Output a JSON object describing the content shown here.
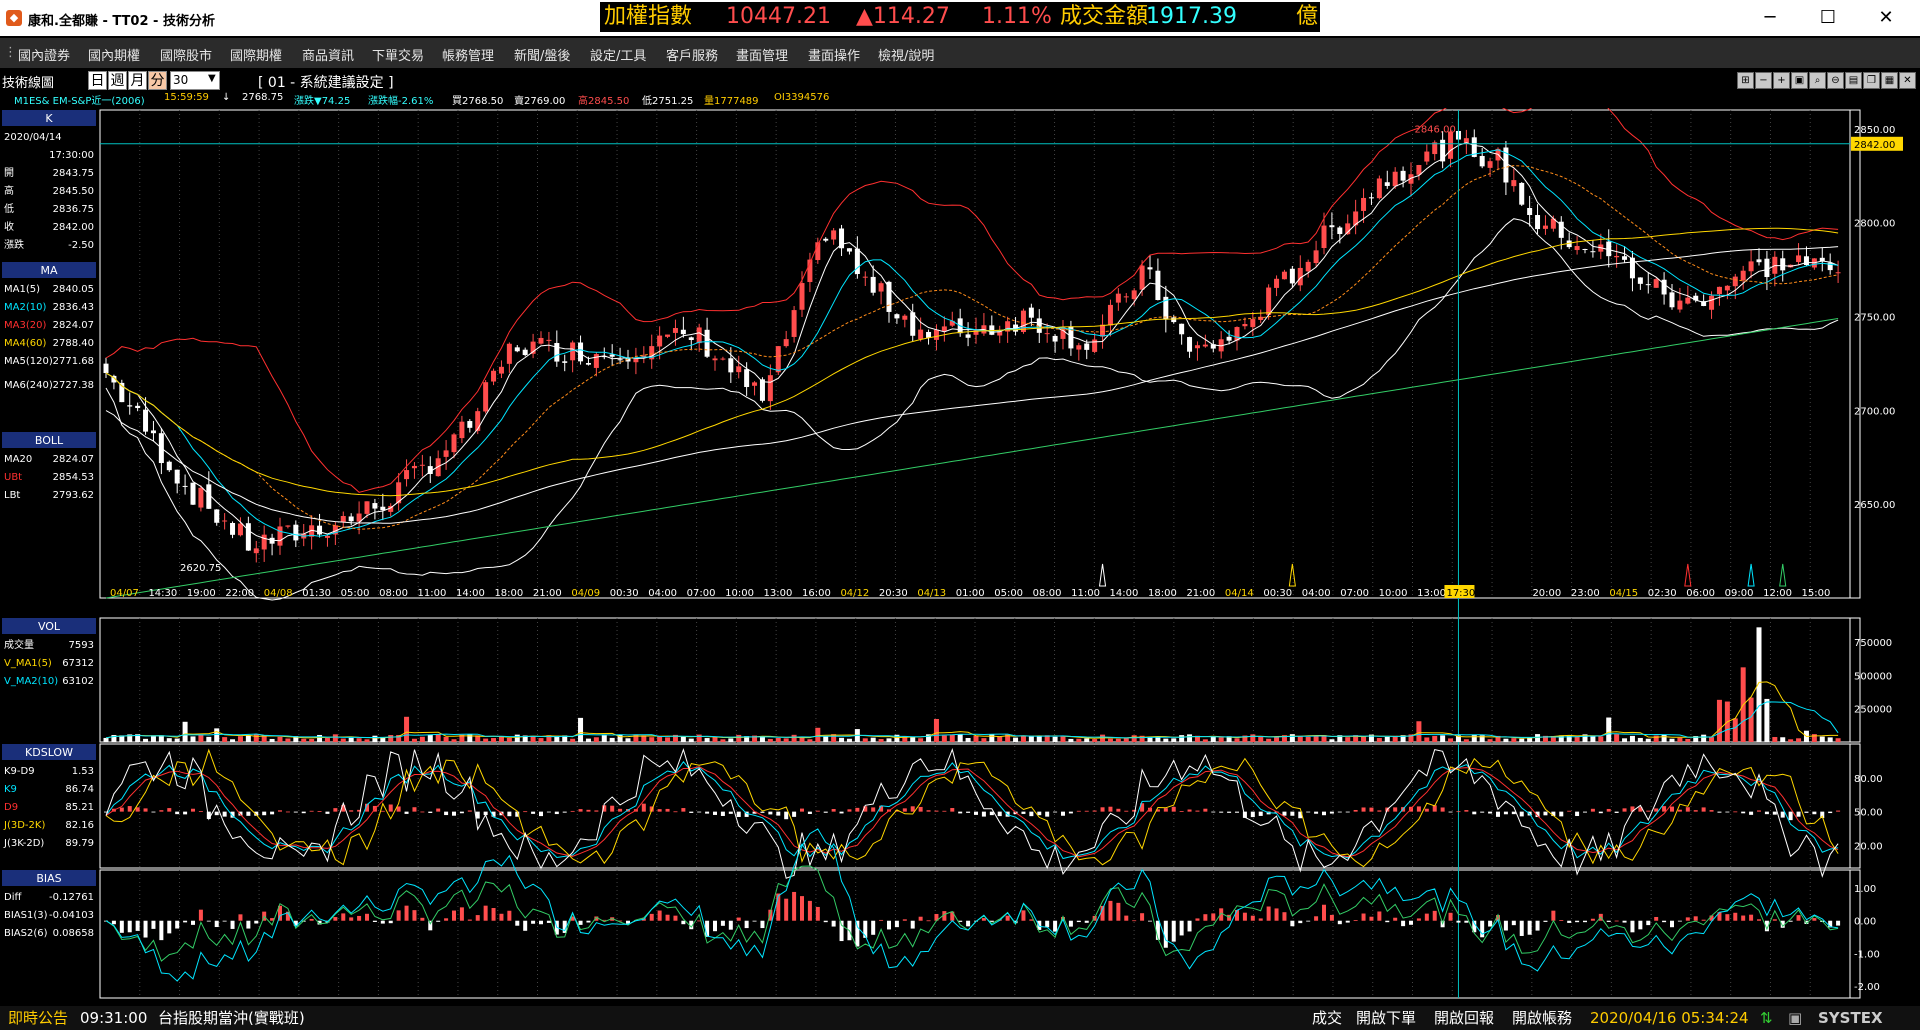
{
  "window": {
    "title": "康和.全都賺 - TT02 - 技術分析",
    "minimize": "─",
    "maximize": "☐",
    "close": "✕"
  },
  "ticker": {
    "label1": "加權指數",
    "index": "10447.21",
    "change": "▲114.27",
    "pct": "1.11%",
    "label2": "成交金額",
    "amount": "1917.39",
    "unit": "億"
  },
  "menu": [
    "國內證券",
    "國內期權",
    "國際股市",
    "國際期權",
    "商品資訊",
    "下單交易",
    "帳務管理",
    "新聞/盤後",
    "設定/工具",
    "客戶服務",
    "畫面管理",
    "畫面操作",
    "檢視/說明"
  ],
  "toolbar": {
    "title": "技術線圖",
    "periods": [
      "日",
      "週",
      "月",
      "分"
    ],
    "selected_period": "分",
    "interval": "30",
    "setting": "[ 01 - 系統建議設定 ]",
    "icon_names": [
      "crosshair-icon",
      "zoom-out-icon",
      "zoom-in-icon",
      "zoom-fit-icon",
      "search-icon",
      "search-minus-icon",
      "print-icon",
      "copy-icon",
      "save-icon",
      "close-icon"
    ]
  },
  "quote": {
    "symbol": "M1ES&  EM-S&P近一(2006)",
    "time": "15:59:59",
    "arrow": "↓",
    "last": "2768.75",
    "change": "漲跌▼74.25",
    "pct": "漲跌幅-2.61%",
    "bid": "買2768.50",
    "ask": "賣2769.00",
    "high": "高2845.50",
    "low": "低2751.25",
    "vol": "量1777489",
    "oi": "OI3394576"
  },
  "panels": {
    "k": {
      "header": "K",
      "date": "2020/04/14",
      "time": "17:30:00",
      "rows": [
        [
          "開",
          "2843.75"
        ],
        [
          "高",
          "2845.50"
        ],
        [
          "低",
          "2836.75"
        ],
        [
          "收",
          "2842.00"
        ],
        [
          "漲跌",
          "-2.50"
        ]
      ]
    },
    "ma": {
      "header": "MA",
      "rows": [
        [
          "MA1(5)",
          "2840.05"
        ],
        [
          "MA2(10)",
          "2836.43"
        ],
        [
          "MA3(20)",
          "2824.07"
        ],
        [
          "MA4(60)",
          "2788.40"
        ],
        [
          "MA5(120)",
          "2771.68"
        ],
        [
          "MA6(240)",
          "2727.38"
        ]
      ]
    },
    "boll": {
      "header": "BOLL",
      "rows": [
        [
          "MA20",
          "2824.07"
        ],
        [
          "UBt",
          "2854.53"
        ],
        [
          "LBt",
          "2793.62"
        ]
      ]
    },
    "vol": {
      "header": "VOL",
      "rows": [
        [
          "成交量",
          "7593"
        ],
        [
          "V_MA1(5)",
          "67312"
        ],
        [
          "V_MA2(10)",
          "63102"
        ]
      ]
    },
    "kd": {
      "header": "KDSLOW",
      "rows": [
        [
          "K9-D9",
          "1.53"
        ],
        [
          "K9",
          "86.74"
        ],
        [
          "D9",
          "85.21"
        ],
        [
          "J(3D-2K)",
          "82.16"
        ],
        [
          "J(3K-2D)",
          "89.79"
        ]
      ]
    },
    "bias": {
      "header": "BIAS",
      "rows": [
        [
          "Diff",
          "-0.12761"
        ],
        [
          "BIAS1(3)",
          "-0.04103"
        ],
        [
          "BIAS2(6)",
          "0.08658"
        ]
      ]
    }
  },
  "axes": {
    "price_ticks": [
      "2850.00",
      "2800.00",
      "2750.00",
      "2700.00",
      "2650.00"
    ],
    "current_price": "2842.00",
    "high_label": "2846.00",
    "low_label": "2620.75",
    "vol_ticks": [
      "750000",
      "500000",
      "250000"
    ],
    "kd_ticks": [
      "80.00",
      "50.00",
      "20.00"
    ],
    "bias_ticks": [
      "1.00",
      "0.00",
      "-1.00",
      "-2.00"
    ],
    "time_labels": [
      "04/07",
      "14:30",
      "19:00",
      "22:00",
      "04/08",
      "01:30",
      "05:00",
      "08:00",
      "11:00",
      "14:00",
      "18:00",
      "21:00",
      "04/09",
      "00:30",
      "04:00",
      "07:00",
      "10:00",
      "13:00",
      "16:00",
      "04/12",
      "20:30",
      "04/13",
      "01:00",
      "05:00",
      "08:00",
      "11:00",
      "14:00",
      "18:00",
      "21:00",
      "04/14",
      "00:30",
      "04:00",
      "07:00",
      "10:00",
      "13:00",
      "1",
      "17:30",
      "20:00",
      "23:00",
      "04/15",
      "02:30",
      "06:00",
      "09:00",
      "12:00",
      "15:00"
    ]
  },
  "status": {
    "notice": "即時公告",
    "time": "09:31:00",
    "headline": "台指股期當沖(實戰班)",
    "trade": "成交",
    "open_order": "開啟下單",
    "open_report": "開啟回報",
    "open_account": "開啟帳務",
    "datetime": "2020/04/16 05:34:24",
    "brand": "SYSTEX"
  },
  "colors": {
    "up": "#ff4d4d",
    "down": "#ffffff",
    "ma5": "#ffffff",
    "ma10": "#00e5ff",
    "ma20": "#ff3030",
    "ma60": "#ffd700",
    "ma120": "#ffffff",
    "ma240": "#33cc66",
    "boll": "#ff3030",
    "grid": "#444444",
    "crosshair": "#00c0c0"
  }
}
